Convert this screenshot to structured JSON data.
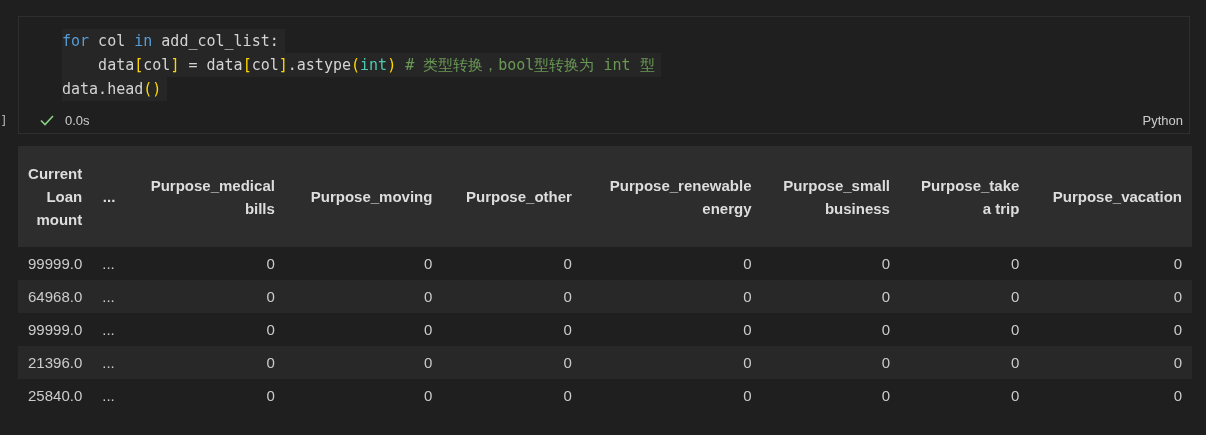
{
  "cell": {
    "gutter_bracket": "]",
    "code_lines": [
      [
        {
          "text": "for",
          "kind": "keyword"
        },
        {
          "text": " col ",
          "kind": "plain"
        },
        {
          "text": "in",
          "kind": "keyword"
        },
        {
          "text": " add_col_list:",
          "kind": "plain"
        }
      ],
      [
        {
          "text": "    data",
          "kind": "plain"
        },
        {
          "text": "[",
          "kind": "bracket"
        },
        {
          "text": "col",
          "kind": "plain"
        },
        {
          "text": "]",
          "kind": "bracket"
        },
        {
          "text": " = data",
          "kind": "plain"
        },
        {
          "text": "[",
          "kind": "bracket"
        },
        {
          "text": "col",
          "kind": "plain"
        },
        {
          "text": "]",
          "kind": "bracket"
        },
        {
          "text": ".astype",
          "kind": "plain"
        },
        {
          "text": "(",
          "kind": "bracket"
        },
        {
          "text": "int",
          "kind": "type"
        },
        {
          "text": ")",
          "kind": "bracket"
        },
        {
          "text": " # 类型转换，bool型转换为 int 型",
          "kind": "comment"
        }
      ],
      [
        {
          "text": "data.head",
          "kind": "plain"
        },
        {
          "text": "()",
          "kind": "bracket"
        }
      ]
    ],
    "status": {
      "succeeded": true,
      "duration": "0.0s",
      "language": "Python"
    }
  },
  "table": {
    "columns": [
      "Current Loan mount",
      "...",
      "Purpose_medical bills",
      "Purpose_moving",
      "Purpose_other",
      "Purpose_renewable energy",
      "Purpose_small business",
      "Purpose_take a trip",
      "Purpose_vacation"
    ],
    "rows": [
      [
        "99999.0",
        "...",
        "0",
        "0",
        "0",
        "0",
        "0",
        "0",
        "0"
      ],
      [
        "64968.0",
        "...",
        "0",
        "0",
        "0",
        "0",
        "0",
        "0",
        "0"
      ],
      [
        "99999.0",
        "...",
        "0",
        "0",
        "0",
        "0",
        "0",
        "0",
        "0"
      ],
      [
        "21396.0",
        "...",
        "0",
        "0",
        "0",
        "0",
        "0",
        "0",
        "0"
      ],
      [
        "25840.0",
        "...",
        "0",
        "0",
        "0",
        "0",
        "0",
        "0",
        "0"
      ]
    ]
  }
}
